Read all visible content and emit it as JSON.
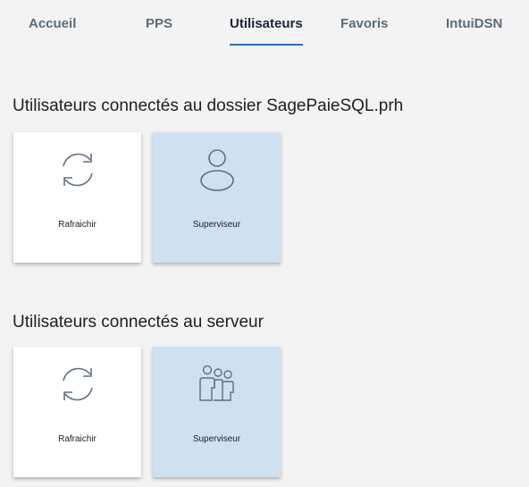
{
  "tabs": [
    {
      "label": "Accueil",
      "active": false
    },
    {
      "label": "PPS",
      "active": false
    },
    {
      "label": "Utilisateurs",
      "active": true
    },
    {
      "label": "Favoris",
      "active": false
    },
    {
      "label": "IntuiDSN",
      "active": false
    }
  ],
  "sections": [
    {
      "title": "Utilisateurs connectés au dossier SagePaieSQL.prh",
      "tiles": [
        {
          "label": "Rafraichir",
          "icon": "refresh-icon"
        },
        {
          "label": "Superviseur",
          "icon": "user-icon"
        }
      ]
    },
    {
      "title": "Utilisateurs connectés au serveur",
      "tiles": [
        {
          "label": "Rafraichir",
          "icon": "refresh-icon"
        },
        {
          "label": "Superviseur",
          "icon": "users-group-icon"
        }
      ]
    }
  ],
  "colors": {
    "tab_active": "#1b2631",
    "tab_inactive": "#5b6b7a",
    "tab_underline": "#1e6fd0",
    "tile_white": "#ffffff",
    "tile_selected": "#cfe0f1",
    "background": "#f3f3f3"
  }
}
